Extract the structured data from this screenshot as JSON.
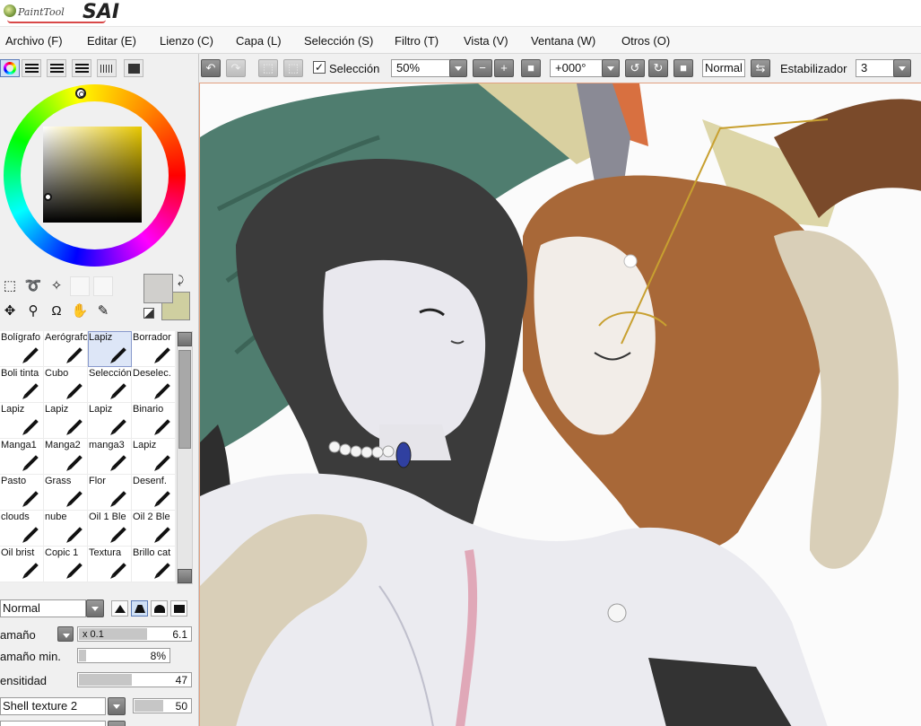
{
  "app": {
    "logo_small": "PaintTool",
    "logo_big": "SAI"
  },
  "menu": [
    "Archivo (F)",
    "Editar (E)",
    "Lienzo (C)",
    "Capa (L)",
    "Selección (S)",
    "Filtro (T)",
    "Vista (V)",
    "Ventana (W)",
    "Otros (O)"
  ],
  "toolbar": {
    "selection_label": "Selección",
    "selection_checked": true,
    "zoom": "50%",
    "rotation": "+000°",
    "view_mode": "Normal",
    "stabilizer_label": "Estabilizador",
    "stabilizer_value": "3"
  },
  "colors": {
    "primary": "#d0cfcc",
    "secondary": "#cfcfa0",
    "accent": "#5a7ab8"
  },
  "brushes": [
    "Bolígrafo",
    "Aerógrafo",
    "Lapiz",
    "Borrador",
    "Boli tinta",
    "Cubo",
    "Selección",
    "Deselec.",
    "Lapiz",
    "Lapiz",
    "Lapiz",
    "Binario",
    "Manga1",
    "Manga2",
    "manga3",
    "Lapiz",
    "Pasto",
    "Grass",
    "Flor",
    "Desenf.",
    "clouds",
    "nube",
    "Oil 1 Ble",
    "Oil 2 Ble",
    "Oil brist",
    "Copic 1",
    "Textura",
    "Brillo cat"
  ],
  "selected_brush_index": 2,
  "brush_settings": {
    "blend_mode": "Normal",
    "size_label": "amaño",
    "size_multiplier": "x 0.1",
    "size_value": "6.1",
    "min_size_label": "amaño min.",
    "min_size_value": "8%",
    "density_label": "ensitidad",
    "density_value": "47",
    "texture_name": "Shell texture 2",
    "texture_value": "50"
  }
}
